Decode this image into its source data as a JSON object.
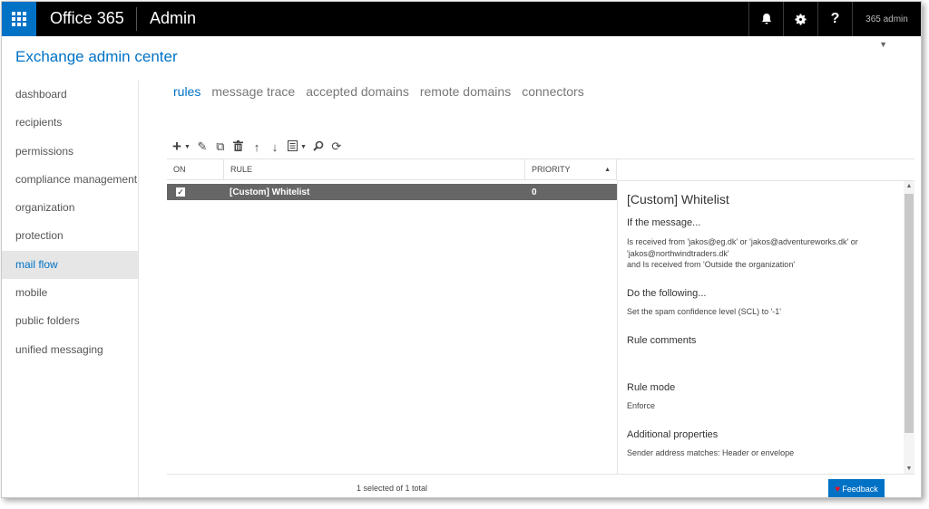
{
  "topbar": {
    "brand": "Office 365",
    "app": "Admin",
    "user": "365 admin",
    "icons": [
      "bell-icon",
      "gear-icon",
      "help-icon"
    ]
  },
  "header": {
    "title": "Exchange admin center"
  },
  "nav": {
    "items": [
      {
        "label": "dashboard"
      },
      {
        "label": "recipients"
      },
      {
        "label": "permissions"
      },
      {
        "label": "compliance management"
      },
      {
        "label": "organization"
      },
      {
        "label": "protection"
      },
      {
        "label": "mail flow",
        "active": true
      },
      {
        "label": "mobile"
      },
      {
        "label": "public folders"
      },
      {
        "label": "unified messaging"
      }
    ]
  },
  "tabs": [
    {
      "label": "rules",
      "active": true
    },
    {
      "label": "message trace"
    },
    {
      "label": "accepted domains"
    },
    {
      "label": "remote domains"
    },
    {
      "label": "connectors"
    }
  ],
  "toolbar": {
    "icons": [
      "add-icon",
      "edit-icon",
      "copy-icon",
      "delete-icon",
      "move-up-icon",
      "move-down-icon",
      "more-icon",
      "search-icon",
      "refresh-icon"
    ]
  },
  "grid": {
    "columns": {
      "on": "ON",
      "rule": "RULE",
      "priority": "PRIORITY"
    },
    "rows": [
      {
        "on": true,
        "rule": "[Custom] Whitelist",
        "priority": "0"
      }
    ],
    "status": "1 selected of 1 total"
  },
  "details": {
    "title": "[Custom] Whitelist",
    "if_heading": "If the message...",
    "if_text_1": "Is received from 'jakos@eg.dk' or 'jakos@adventureworks.dk' or 'jakos@northwindtraders.dk'",
    "if_text_2": "and Is received from 'Outside the organization'",
    "do_heading": "Do the following...",
    "do_text": "Set the spam confidence level (SCL) to '-1'",
    "comments_heading": "Rule comments",
    "mode_heading": "Rule mode",
    "mode_text": "Enforce",
    "props_heading": "Additional properties",
    "props_text": "Sender address matches: Header or envelope"
  },
  "feedback": {
    "label": "Feedback"
  },
  "colors": {
    "accent": "#0072c6",
    "topbar": "#000000",
    "selected_row": "#666666"
  }
}
